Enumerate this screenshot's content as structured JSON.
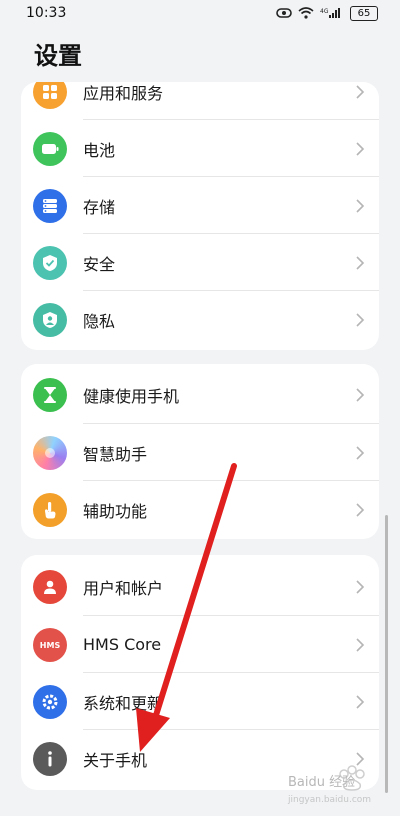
{
  "status_bar": {
    "time": "10:33",
    "signal_label": "4G",
    "battery": "65"
  },
  "page": {
    "title": "设置"
  },
  "groups": [
    {
      "items": [
        {
          "label": "应用和服务",
          "icon": "apps-icon",
          "color": "#f7a130"
        },
        {
          "label": "电池",
          "icon": "battery-icon",
          "color": "#3fc45c"
        },
        {
          "label": "存储",
          "icon": "storage-icon",
          "color": "#2f6fe8"
        },
        {
          "label": "安全",
          "icon": "shield-icon",
          "color": "#4cc2b0"
        },
        {
          "label": "隐私",
          "icon": "privacy-icon",
          "color": "#46bca5"
        }
      ]
    },
    {
      "items": [
        {
          "label": "健康使用手机",
          "icon": "hourglass-icon",
          "color": "#3bbf4f"
        },
        {
          "label": "智慧助手",
          "icon": "assistant-icon",
          "color": "#9a7ff0"
        },
        {
          "label": "辅助功能",
          "icon": "accessibility-icon",
          "color": "#f3a02a"
        }
      ]
    },
    {
      "items": [
        {
          "label": "用户和帐户",
          "icon": "user-icon",
          "color": "#e5483a"
        },
        {
          "label": "HMS Core",
          "icon": "hms-icon",
          "color": "#e3524a"
        },
        {
          "label": "系统和更新",
          "icon": "settings-update-icon",
          "color": "#2f6fe8"
        },
        {
          "label": "关于手机",
          "icon": "info-icon",
          "color": "#5a5a5a"
        }
      ]
    }
  ],
  "watermark": {
    "text": "Baidu 经验",
    "sub": "jingyan.baidu.com"
  },
  "colors": {
    "background": "#f1f3f5",
    "card": "#ffffff",
    "annotation_arrow": "#e0201f"
  }
}
